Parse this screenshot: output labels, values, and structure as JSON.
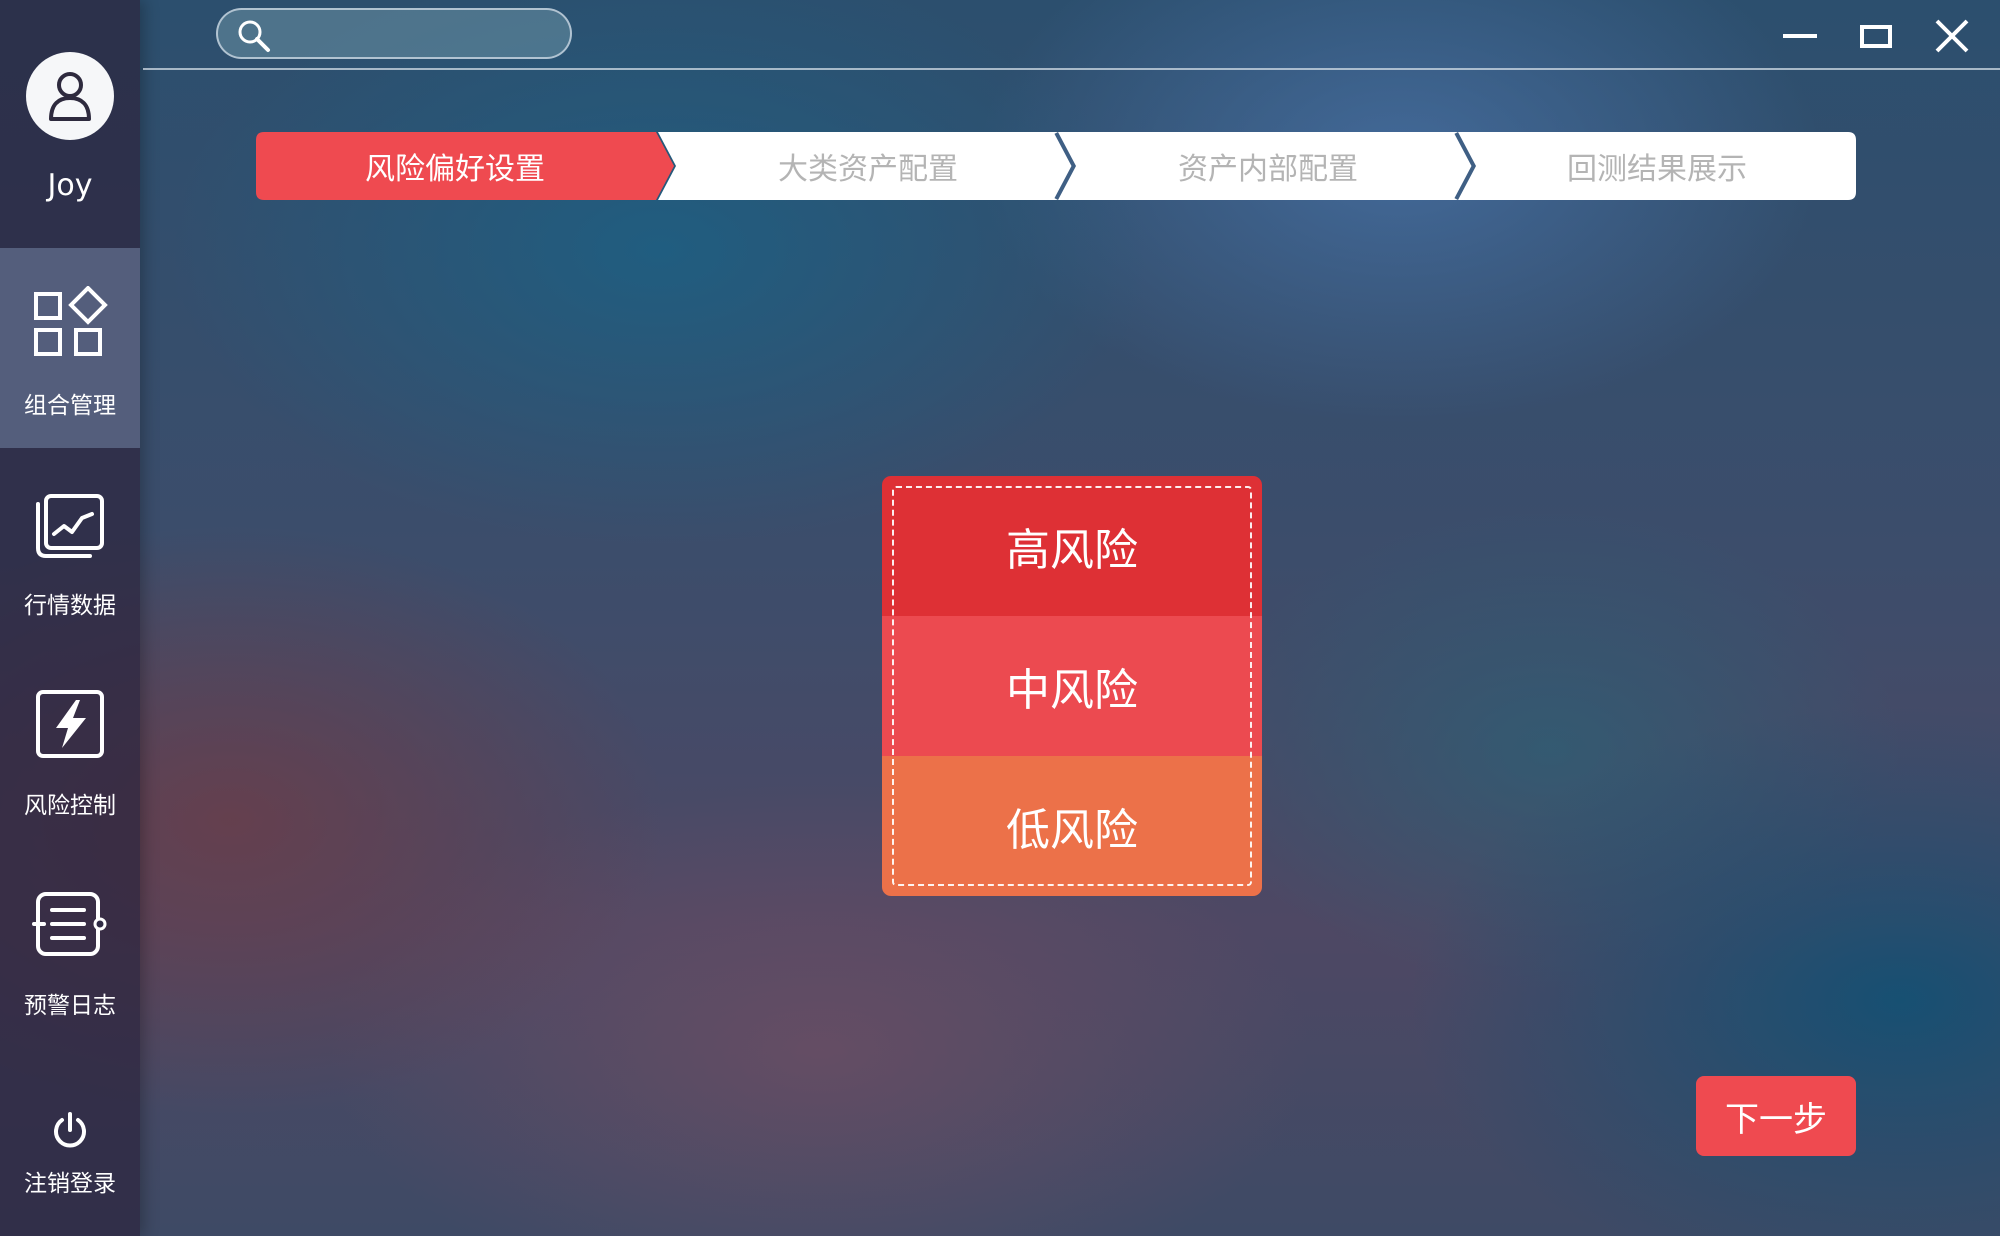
{
  "user": {
    "name": "Joy",
    "avatar_icon": "user-icon"
  },
  "sidebar": {
    "items": [
      {
        "label": "组合管理",
        "icon": "grid-icon",
        "active": true
      },
      {
        "label": "行情数据",
        "icon": "chart-icon",
        "active": false
      },
      {
        "label": "风险控制",
        "icon": "lightning-icon",
        "active": false
      },
      {
        "label": "预警日志",
        "icon": "list-icon",
        "active": false
      }
    ],
    "logout": {
      "label": "注销登录",
      "icon": "power-icon"
    }
  },
  "search": {
    "value": "",
    "placeholder": ""
  },
  "window_controls": [
    "minimize-icon",
    "maximize-icon",
    "close-icon"
  ],
  "steps": [
    {
      "label": "风险偏好设置",
      "active": true
    },
    {
      "label": "大类资产配置",
      "active": false
    },
    {
      "label": "资产内部配置",
      "active": false
    },
    {
      "label": "回测结果展示",
      "active": false
    }
  ],
  "risk_options": [
    {
      "label": "高风险",
      "color": "#de3035"
    },
    {
      "label": "中风险",
      "color": "#ec4a50"
    },
    {
      "label": "低风险",
      "color": "#ec7149"
    }
  ],
  "next_button": {
    "label": "下一步",
    "color": "#ef4a50"
  },
  "colors": {
    "accent": "#ef4a50",
    "step_inactive_text": "#b4b4b4",
    "step_divider": "#3f5f84"
  }
}
